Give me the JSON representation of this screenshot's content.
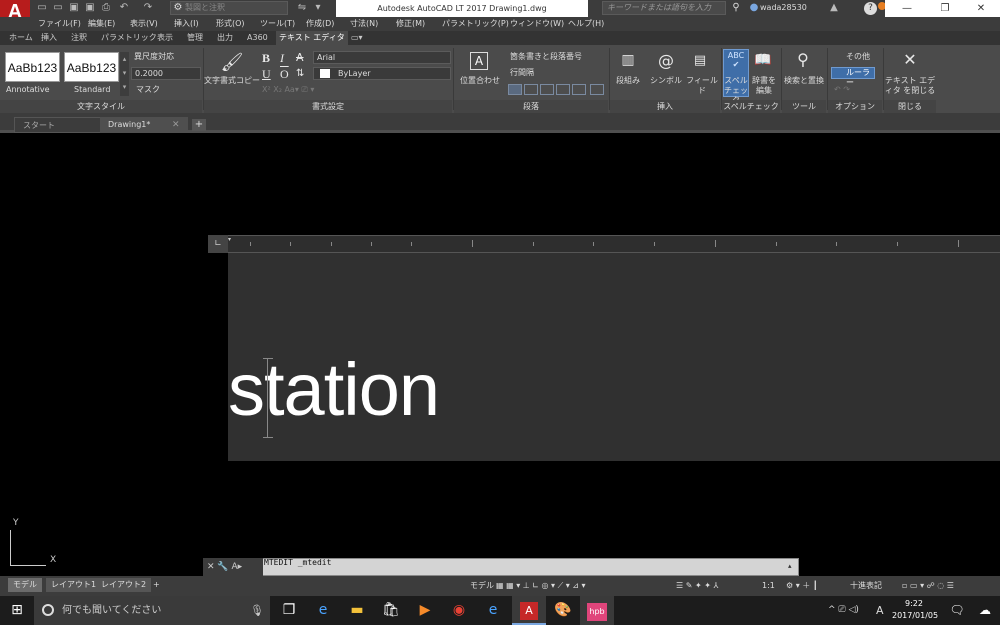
{
  "titlebar": {
    "app_logo": "A",
    "app_logo_sub": "LT",
    "workspace": "製図と注釈",
    "title": "Autodesk AutoCAD LT 2017   Drawing1.dwg",
    "search_placeholder": "キーワードまたは語句を入力",
    "username": "wada28530",
    "help": "?"
  },
  "menu": [
    "ファイル(F)",
    "編集(E)",
    "表示(V)",
    "挿入(I)",
    "形式(O)",
    "ツール(T)",
    "作成(D)",
    "寸法(N)",
    "修正(M)",
    "パラメトリック(P)",
    "ウィンドウ(W)",
    "ヘルプ(H)"
  ],
  "ribbon_tabs": [
    "ホーム",
    "挿入",
    "注釈",
    "パラメトリック",
    "表示",
    "管理",
    "出力",
    "A360",
    "テキスト エディタ"
  ],
  "ribbon": {
    "text_style": {
      "style1": "AaBb123",
      "style1_name": "Annotative",
      "style2": "AaBb123",
      "style2_name": "Standard",
      "annotative_label": "異尺度対応",
      "height": "0.2000",
      "mask_label": "マスク",
      "title": "文字スタイル"
    },
    "format": {
      "copy_label": "文字書式コピー",
      "bold": "B",
      "italic": "I",
      "strike": "A",
      "underline": "U",
      "overline": "O",
      "font": "Arial",
      "color": "ByLayer",
      "title": "書式設定"
    },
    "paragraph": {
      "justify_label": "位置合わせ",
      "bullets_label": "箇条書きと段落番号",
      "line_spacing_label": "行間隔",
      "title": "段落"
    },
    "insert": {
      "columns_label": "段組み",
      "symbol_label": "シンボル",
      "field_label": "フィールド",
      "title": "挿入"
    },
    "spell": {
      "spell_label": "スペル チェック",
      "dict_label": "辞書を 編集",
      "title": "スペルチェック"
    },
    "tools": {
      "find_label": "検索と置換",
      "title": "ツール"
    },
    "options": {
      "more_label": "その他",
      "ruler_label": "ルーラー",
      "title": "オプション"
    },
    "close": {
      "close_label": "テキスト エディタ を閉じる",
      "title": "閉じる"
    }
  },
  "doc_tabs": [
    "スタート",
    "Drawing1*"
  ],
  "editor": {
    "text": "station"
  },
  "ucs": {
    "x": "X",
    "y": "Y"
  },
  "command": {
    "text": "MTEDIT _mtedit"
  },
  "layout_tabs": [
    "モデル",
    "レイアウト1",
    "レイアウト2"
  ],
  "status": {
    "model": "モデル",
    "scale": "1:1",
    "units": "十進表記"
  },
  "taskbar": {
    "search_placeholder": "何でも聞いてください",
    "time": "9:22",
    "date": "2017/01/05",
    "ime": "A"
  }
}
